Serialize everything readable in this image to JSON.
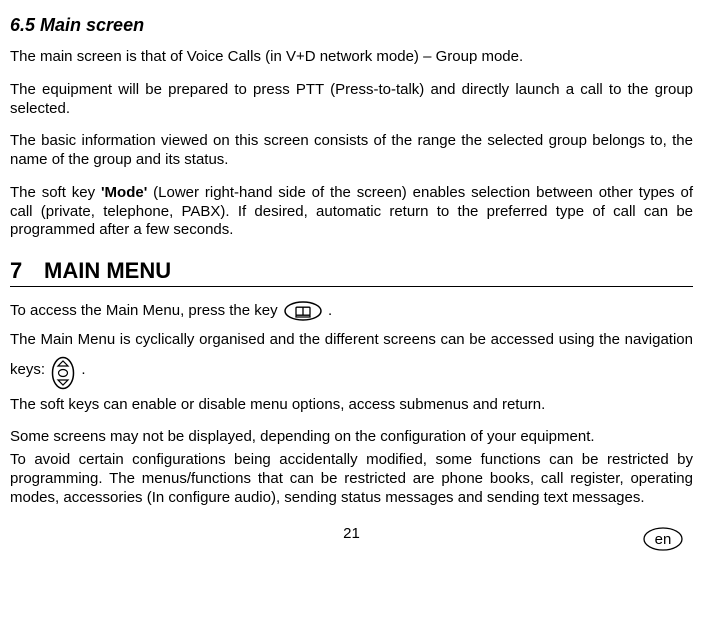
{
  "section65": {
    "heading": "6.5 Main screen",
    "p1": "The main screen is that of Voice Calls  (in V+D network mode) – Group mode.",
    "p2": "The equipment will be prepared to press PTT (Press-to-talk) and directly launch a call to the group selected.",
    "p3": "The basic  information viewed on this screen consists of the range the selected group belongs to, the name of the group and its status.",
    "p4a": "The soft key ",
    "p4_mode": "'Mode'",
    "p4b": " (Lower right-hand side of the screen) enables selection between other types of call (private, telephone, PABX). If desired, automatic return to the preferred type of call can be programmed after a few seconds."
  },
  "section7": {
    "number": "7",
    "title": "MAIN MENU",
    "p1a": "To access the Main Menu, press the key ",
    "p1b": "  .",
    "p2a": "The Main Menu is cyclically organised and the different screens can be accessed using the navigation keys:  ",
    "p2b": " .",
    "p3": "The soft keys can enable or disable menu options, access submenus and return.",
    "p4": "Some screens may not be displayed, depending on the configuration of your equipment.",
    "p5": "To avoid certain configurations being accidentally modified, some functions can be restricted by programming. The menus/functions that can be restricted are phone books, call register, operating modes, accessories (In configure audio), sending status messages and sending text messages."
  },
  "footer": {
    "page": "21",
    "lang": "en"
  },
  "icons": {
    "menu": "menu-key-icon",
    "nav": "navigation-key-icon"
  }
}
